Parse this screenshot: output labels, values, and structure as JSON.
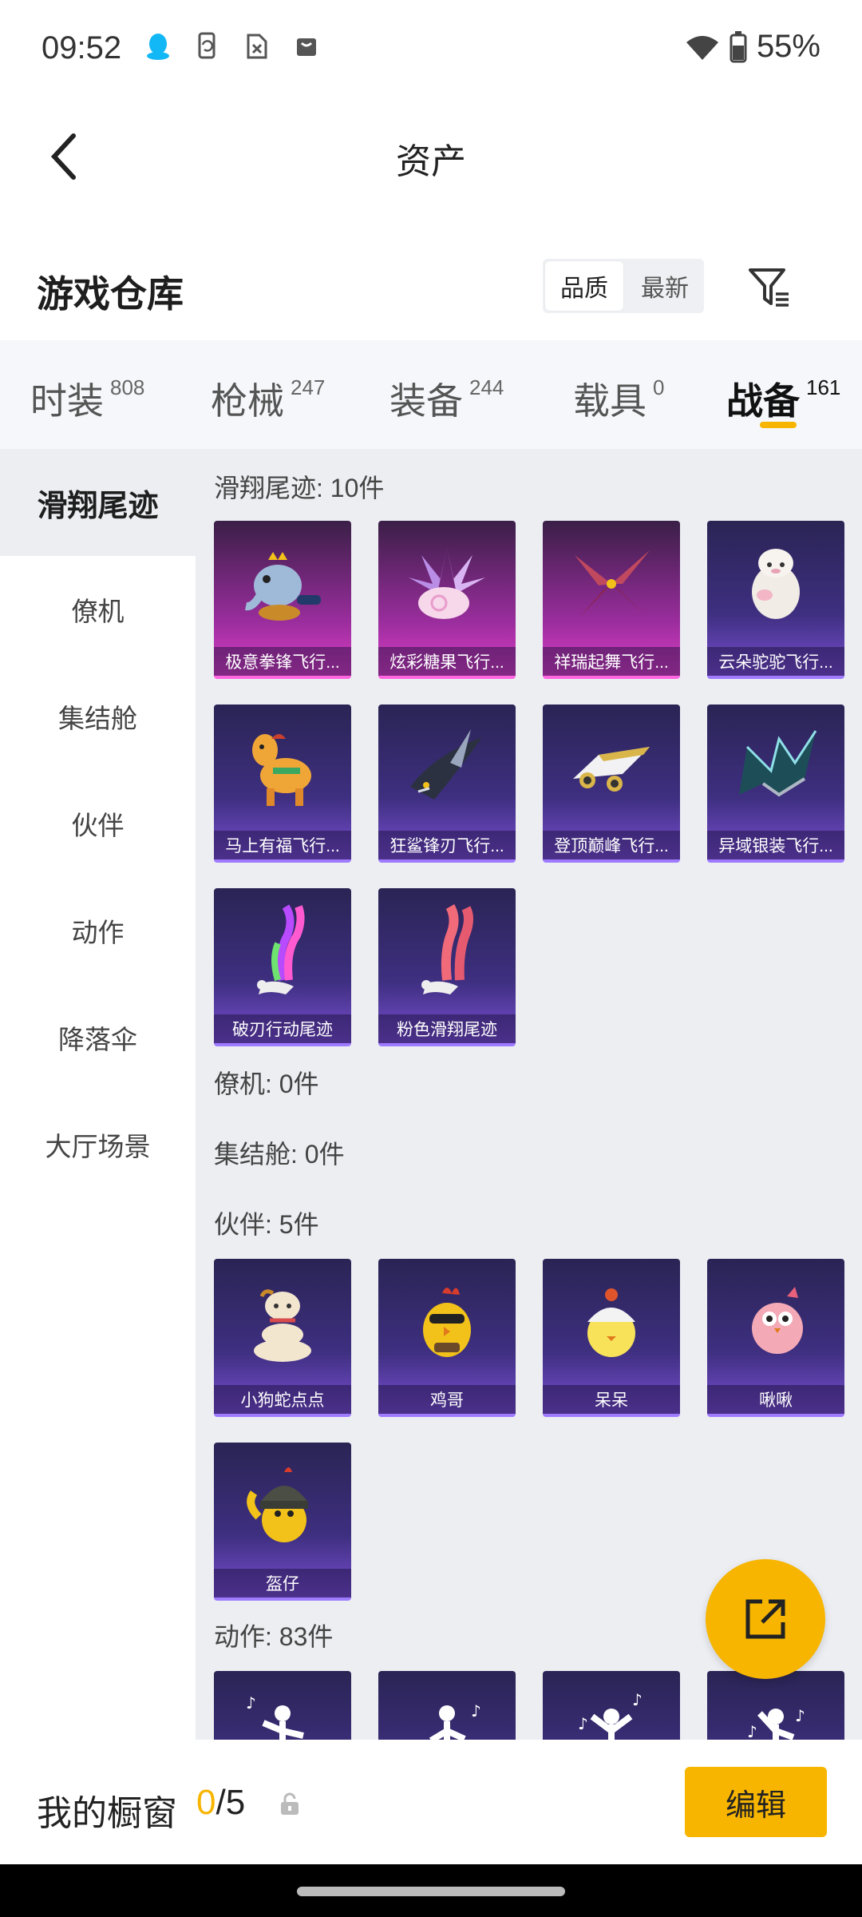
{
  "status_bar": {
    "time": "09:52",
    "battery": "55%"
  },
  "title_bar": {
    "title": "资产"
  },
  "warehouse": {
    "title": "游戏仓库",
    "sort_options": [
      "品质",
      "最新"
    ],
    "active_sort": "品质"
  },
  "category_tabs": [
    {
      "label": "时装",
      "count": "808"
    },
    {
      "label": "枪械",
      "count": "247"
    },
    {
      "label": "装备",
      "count": "244"
    },
    {
      "label": "载具",
      "count": "0"
    },
    {
      "label": "战备",
      "count": "161",
      "active": true
    }
  ],
  "side_nav": [
    {
      "label": "滑翔尾迹",
      "active": true
    },
    {
      "label": "僚机"
    },
    {
      "label": "集结舱"
    },
    {
      "label": "伙伴"
    },
    {
      "label": "动作"
    },
    {
      "label": "降落伞"
    },
    {
      "label": "大厅场景"
    }
  ],
  "sections": {
    "glide_trail": {
      "title": "滑翔尾迹: 10件",
      "items": [
        {
          "label": "极意拳锋飞行...",
          "tier": "pink"
        },
        {
          "label": "炫彩糖果飞行...",
          "tier": "pink"
        },
        {
          "label": "祥瑞起舞飞行...",
          "tier": "pink"
        },
        {
          "label": "云朵驼驼飞行...",
          "tier": "purple"
        },
        {
          "label": "马上有福飞行...",
          "tier": "purple"
        },
        {
          "label": "狂鲨锋刃飞行...",
          "tier": "purple"
        },
        {
          "label": "登顶巅峰飞行...",
          "tier": "purple"
        },
        {
          "label": "异域银装飞行...",
          "tier": "purple"
        },
        {
          "label": "破刃行动尾迹",
          "tier": "purple"
        },
        {
          "label": "粉色滑翔尾迹",
          "tier": "purple"
        }
      ]
    },
    "wingman": {
      "title": "僚机: 0件"
    },
    "capsule": {
      "title": "集结舱: 0件"
    },
    "partner": {
      "title": "伙伴: 5件",
      "items": [
        {
          "label": "小狗蛇点点"
        },
        {
          "label": "鸡哥"
        },
        {
          "label": "呆呆"
        },
        {
          "label": "啾啾"
        },
        {
          "label": "盔仔"
        }
      ]
    },
    "action": {
      "title": "动作: 83件"
    }
  },
  "bottom_bar": {
    "label": "我的橱窗",
    "current": "0",
    "total": "/5",
    "edit_label": "编辑"
  },
  "colors": {
    "accent": "#f7b500",
    "card_purple": "#3e2f80",
    "card_pink": "#9a2d9d"
  }
}
